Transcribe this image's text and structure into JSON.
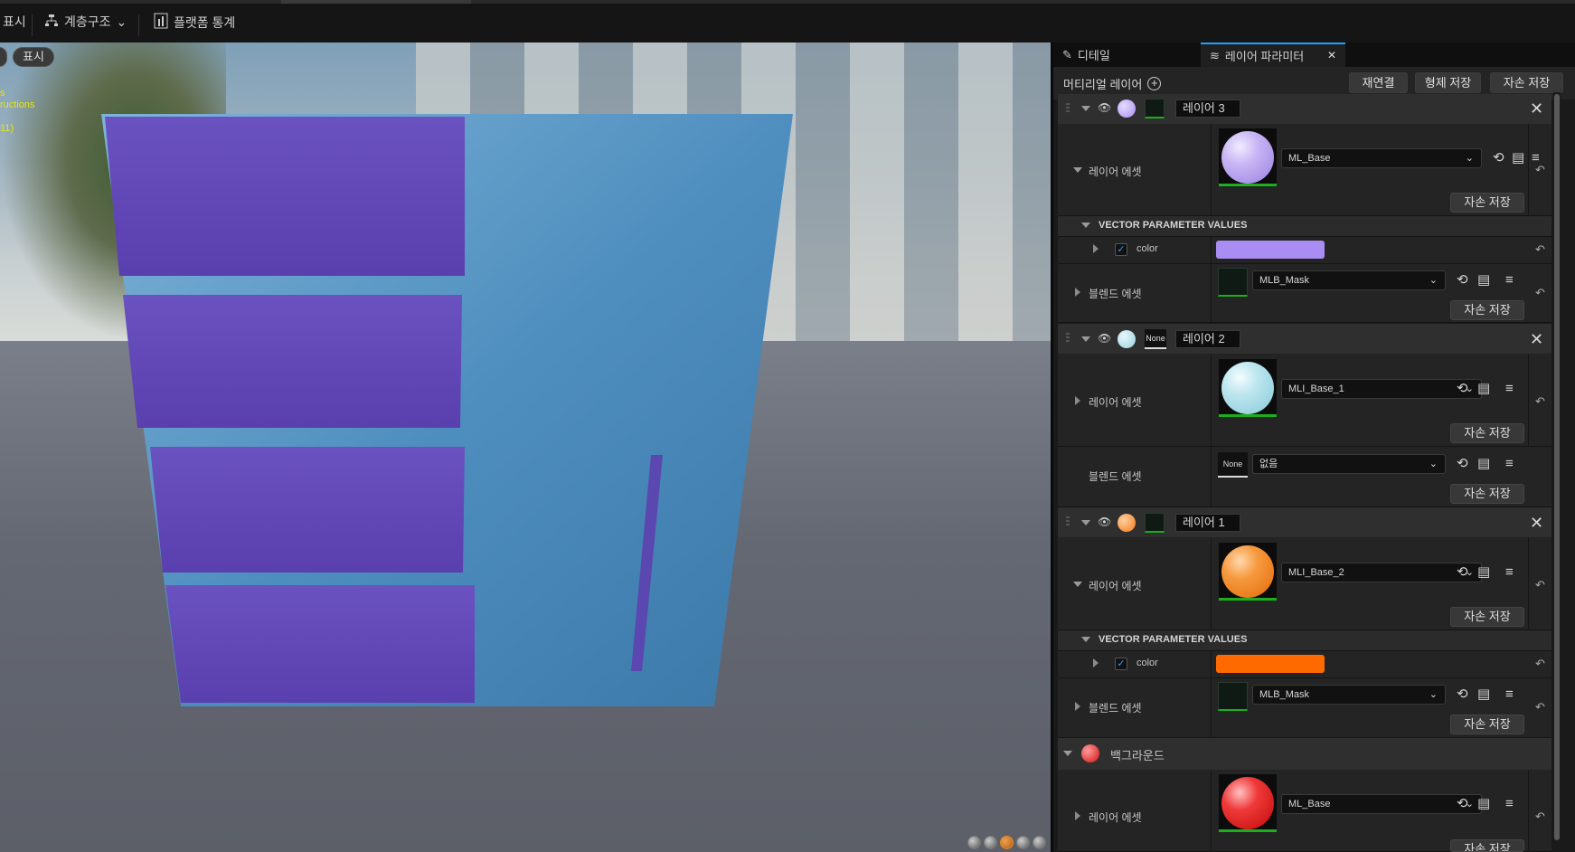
{
  "toolbar": {
    "show_label": "표시",
    "hierarchy_label": "계층구조",
    "platform_stats_label": "플랫폼 통계"
  },
  "viewport": {
    "show_button": "표시",
    "notes": [
      "s",
      "ructions",
      "11)"
    ]
  },
  "panel": {
    "tabs": [
      {
        "label": "디테일",
        "icon": "pencil-icon"
      },
      {
        "label": "레이어 파라미터",
        "icon": "layers-icon"
      }
    ],
    "material_layers_label": "머티리얼 레이어",
    "buttons": {
      "relink": "재연결",
      "save_sibling": "형제 저장",
      "save_child": "자손 저장"
    },
    "layer_asset_label": "레이어 에셋",
    "blend_asset_label": "블렌드 에셋",
    "save_child_label": "자손 저장",
    "vector_header": "VECTOR PARAMETER VALUES",
    "color_label": "color",
    "none_label": "None",
    "layers": [
      {
        "name": "레이어 3",
        "asset": "ML_Base",
        "blend": "MLB_Mask",
        "color": "#a98df2",
        "sphere": "#b7a2f0"
      },
      {
        "name": "레이어 2",
        "asset": "MLI_Base_1",
        "blend": "없음",
        "sphere": "#a9dbe6"
      },
      {
        "name": "레이어 1",
        "asset": "MLI_Base_2",
        "blend": "MLB_Mask",
        "color": "#ff6a00",
        "sphere": "#f27a17"
      }
    ],
    "background": {
      "name": "백그라운드",
      "asset": "ML_Base",
      "sphere": "#e21a1a"
    }
  }
}
